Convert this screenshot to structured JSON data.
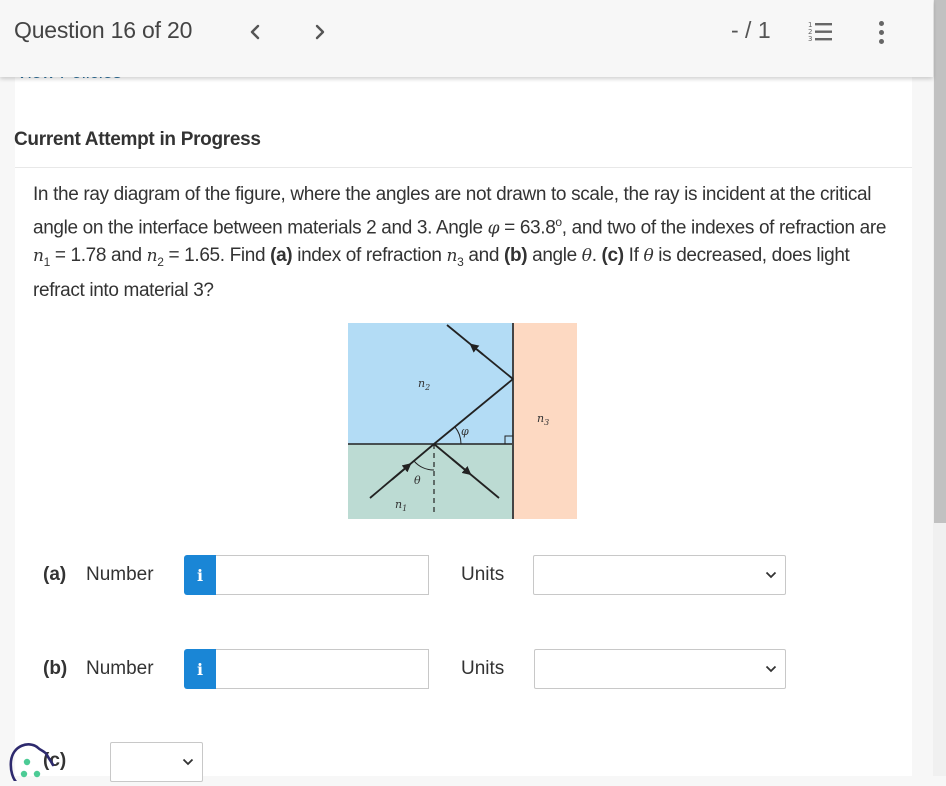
{
  "header": {
    "question_position": "Question 16 of 20",
    "prev_icon": "chevron-left-icon",
    "next_icon": "chevron-right-icon",
    "score": "- / 1",
    "list_icon": "numbered-list-icon",
    "more_icon": "more-vertical-icon"
  },
  "policies_link": "View Policies",
  "attempt_heading": "Current Attempt in Progress",
  "question": {
    "text_1": "In the ray diagram of the figure, where the angles are not drawn to scale, the ray is incident at the critical angle on the interface between materials 2 and 3. Angle ",
    "phi_symbol": "φ",
    "text_2": " = 63.8",
    "degree": "o",
    "text_3": ", and two of the indexes of refraction are ",
    "n_symbol": "n",
    "sub_1": "1",
    "text_4": " = 1.78 and ",
    "sub_2": "2",
    "text_5": " = 1.65. Find ",
    "part_a_bold": "(a)",
    "text_6": " index of refraction ",
    "sub_3": "3",
    "text_7": " and ",
    "part_b_bold": "(b)",
    "text_8": " angle ",
    "theta_symbol": "θ",
    "text_9": ". ",
    "part_c_bold": "(c)",
    "text_10": " If ",
    "text_11": " is decreased, does light refract into material 3?"
  },
  "figure": {
    "label_n1": "n",
    "label_n1_sub": "1",
    "label_n2": "n",
    "label_n2_sub": "2",
    "label_n3": "n",
    "label_n3_sub": "3",
    "label_phi": "φ",
    "label_theta": "θ",
    "colors": {
      "material_2": "#b3dcf5",
      "material_1": "#bcdbd3",
      "material_3": "#fdd9c2"
    }
  },
  "answers": {
    "a": {
      "label": "(a)",
      "number_label": "Number",
      "info_icon": "i",
      "value": "",
      "units_label": "Units",
      "units_selected": ""
    },
    "b": {
      "label": "(b)",
      "number_label": "Number",
      "info_icon": "i",
      "value": "",
      "units_label": "Units",
      "units_selected": ""
    },
    "c": {
      "label": "(c)",
      "selected": ""
    }
  },
  "accent_color": "#1a86d6"
}
